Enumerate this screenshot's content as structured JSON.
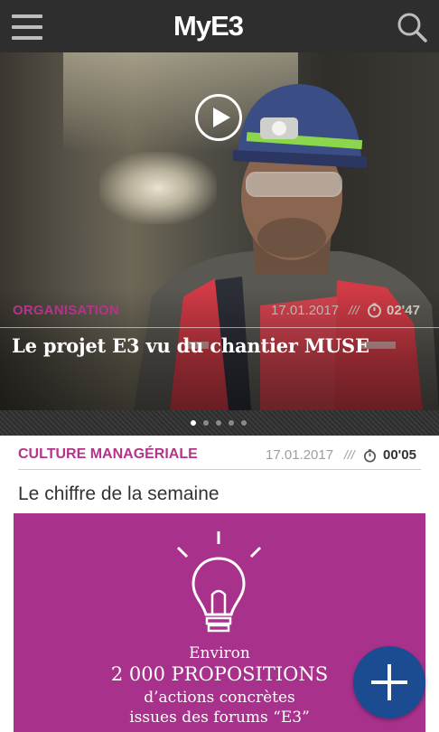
{
  "header": {
    "logo": "MyE3",
    "menu_icon": "hamburger-menu-icon",
    "search_icon": "search-icon"
  },
  "hero": {
    "category": "ORGANISATION",
    "date": "17.01.2017",
    "separator": "///",
    "duration": "02'47",
    "title": "Le projet E3 vu du chantier MUSE",
    "play_icon": "play-icon",
    "pager": {
      "count": 5,
      "active": 1
    }
  },
  "card": {
    "category": "CULTURE MANAGÉRIALE",
    "date": "17.01.2017",
    "separator": "///",
    "duration": "00'05",
    "title": "Le chiffre de la semaine",
    "panel": {
      "line1": "Environ",
      "line2": "2 000 PROPOSITIONS",
      "line3": "d’actions concrètes",
      "line4": "issues des forums “E3”",
      "icon": "lightbulb-icon"
    }
  },
  "fab": {
    "icon": "plus-icon"
  },
  "colors": {
    "accent_magenta": "#b5338a",
    "panel_bg": "#a8318c",
    "fab_blue": "#1b4c91",
    "header_bg": "#2e2e2e"
  }
}
